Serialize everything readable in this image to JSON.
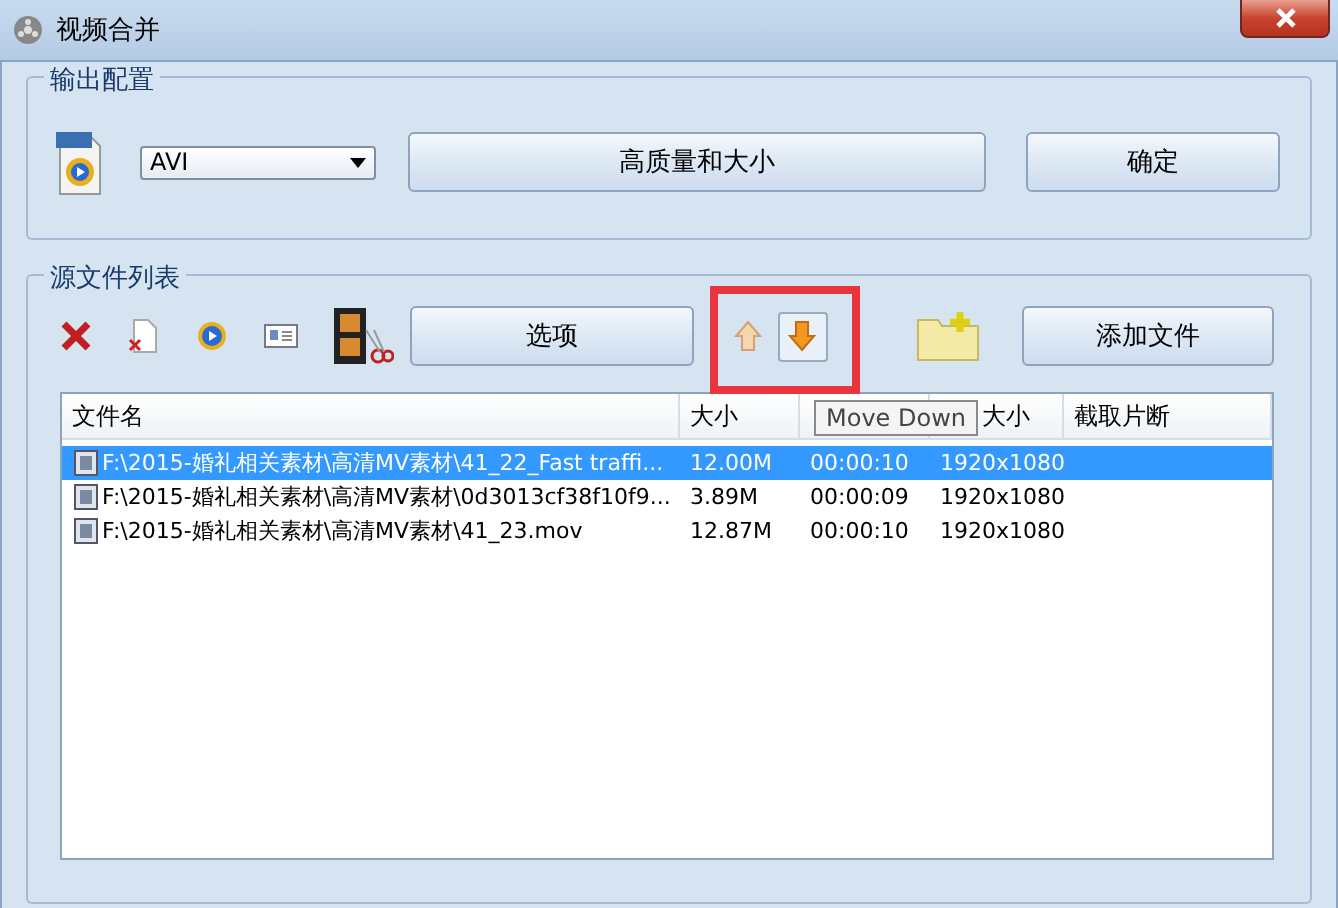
{
  "window": {
    "title": "视频合并"
  },
  "output_config": {
    "title": "输出配置",
    "format": "AVI",
    "quality_button": "高质量和大小",
    "confirm_button": "确定"
  },
  "source_list": {
    "title": "源文件列表",
    "options_button": "选项",
    "add_button": "添加文件",
    "tooltip": "Move Down",
    "columns": [
      {
        "label": "文件名"
      },
      {
        "label": "大小"
      },
      {},
      {
        "label": "大小"
      },
      {
        "label": "截取片断"
      }
    ],
    "rows": [
      {
        "name": "F:\\2015-婚礼相关素材\\高清MV素材\\41_22_Fast traffi...",
        "size": "12.00M",
        "duration": "00:00:10",
        "resolution": "1920x1080",
        "selected": true
      },
      {
        "name": "F:\\2015-婚礼相关素材\\高清MV素材\\0d3013cf38f10f9...",
        "size": "3.89M",
        "duration": "00:00:09",
        "resolution": "1920x1080",
        "selected": false
      },
      {
        "name": "F:\\2015-婚礼相关素材\\高清MV素材\\41_23.mov",
        "size": "12.87M",
        "duration": "00:00:10",
        "resolution": "1920x1080",
        "selected": false
      }
    ]
  }
}
